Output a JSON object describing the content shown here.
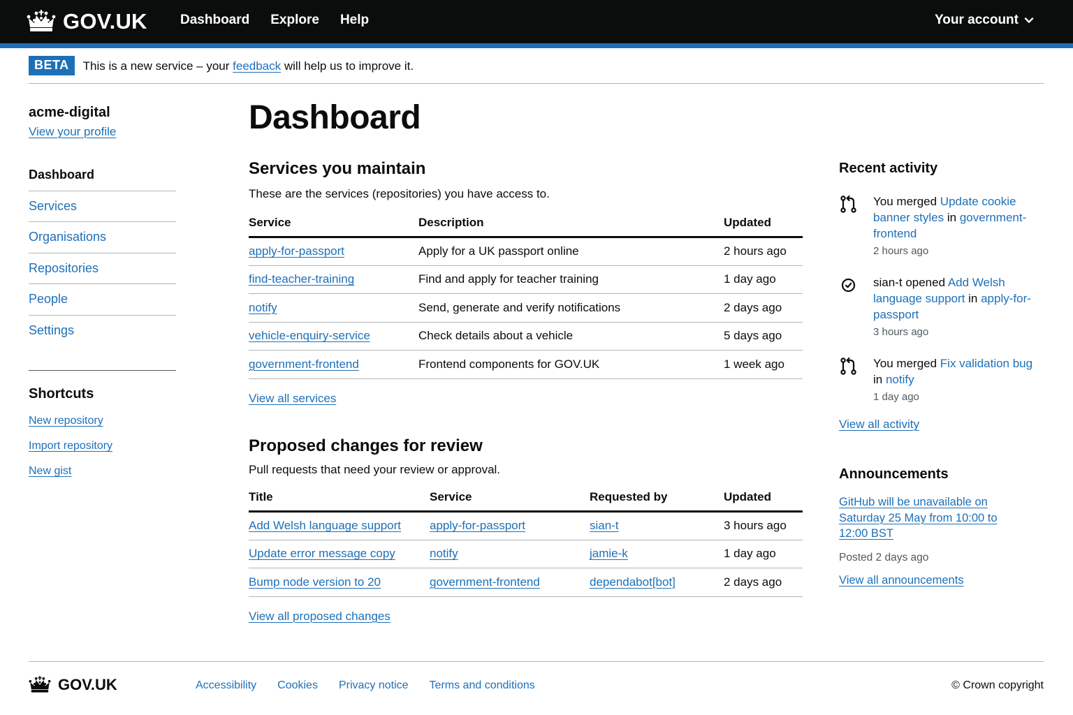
{
  "header": {
    "logo_text": "GOV.UK",
    "nav": [
      "Dashboard",
      "Explore",
      "Help"
    ],
    "account_label": "Your account"
  },
  "beta": {
    "tag": "BETA",
    "text_before": "This is a new service – your ",
    "link": "feedback",
    "text_after": " will help us to improve it."
  },
  "sidebar": {
    "org_name": "acme-digital",
    "profile_link": "View your profile",
    "nav": [
      {
        "label": "Dashboard",
        "active": true
      },
      {
        "label": "Services",
        "active": false
      },
      {
        "label": "Organisations",
        "active": false
      },
      {
        "label": "Repositories",
        "active": false
      },
      {
        "label": "People",
        "active": false
      },
      {
        "label": "Settings",
        "active": false
      }
    ],
    "shortcuts_title": "Shortcuts",
    "shortcuts": [
      "New repository",
      "Import repository",
      "New gist"
    ]
  },
  "main": {
    "title": "Dashboard",
    "services": {
      "title": "Services you maintain",
      "description": "These are the services (repositories) you have access to.",
      "headers": [
        "Service",
        "Description",
        "Updated"
      ],
      "rows": [
        [
          "apply-for-passport",
          "Apply for a UK passport online",
          "2 hours ago"
        ],
        [
          "find-teacher-training",
          "Find and apply for teacher training",
          "1 day ago"
        ],
        [
          "notify",
          "Send, generate and verify notifications",
          "2 days ago"
        ],
        [
          "vehicle-enquiry-service",
          "Check details about a vehicle",
          "5 days ago"
        ],
        [
          "government-frontend",
          "Frontend components for GOV.UK",
          "1 week ago"
        ]
      ],
      "view_all": "View all services"
    },
    "proposed": {
      "title": "Proposed changes for review",
      "description": "Pull requests that need your review or approval.",
      "headers": [
        "Title",
        "Service",
        "Requested by",
        "Updated"
      ],
      "rows": [
        [
          "Add Welsh language support",
          "apply-for-passport",
          "sian-t",
          "3 hours ago"
        ],
        [
          "Update error message copy",
          "notify",
          "jamie-k",
          "1 day ago"
        ],
        [
          "Bump node version to 20",
          "government-frontend",
          "dependabot[bot]",
          "2 days ago"
        ]
      ],
      "view_all": "View all proposed changes"
    }
  },
  "activity": {
    "title": "Recent activity",
    "items": [
      {
        "icon": "merge-icon",
        "actor": "You",
        "verb": "merged",
        "link": "Update cookie banner styles",
        "in_word": "in",
        "repo": "government-frontend",
        "time": "2 hours ago"
      },
      {
        "icon": "pull-request-opened-icon",
        "actor": "sian-t",
        "verb": "opened",
        "link": "Add Welsh language support",
        "in_word": "in",
        "repo": "apply-for-passport",
        "time": "3 hours ago"
      },
      {
        "icon": "merge-icon",
        "actor": "You",
        "verb": "merged",
        "link": "Fix validation bug",
        "in_word": "in",
        "repo": "notify",
        "time": "1 day ago"
      }
    ],
    "view_all": "View all activity"
  },
  "announcements": {
    "title": "Announcements",
    "link": "GitHub will be unavailable on Saturday 25 May from 10:00 to 12:00 BST",
    "posted": "Posted 2 days ago",
    "view_all": "View all announcements"
  },
  "footer": {
    "logo_text": "GOV.UK",
    "links": [
      "Accessibility",
      "Cookies",
      "Privacy notice",
      "Terms and conditions"
    ],
    "copyright": "© Crown copyright"
  },
  "colors": {
    "link": "#1d70b8",
    "header_bg": "#0b0c0c",
    "border": "#b1b4b6",
    "secondary_text": "#505a5f"
  }
}
